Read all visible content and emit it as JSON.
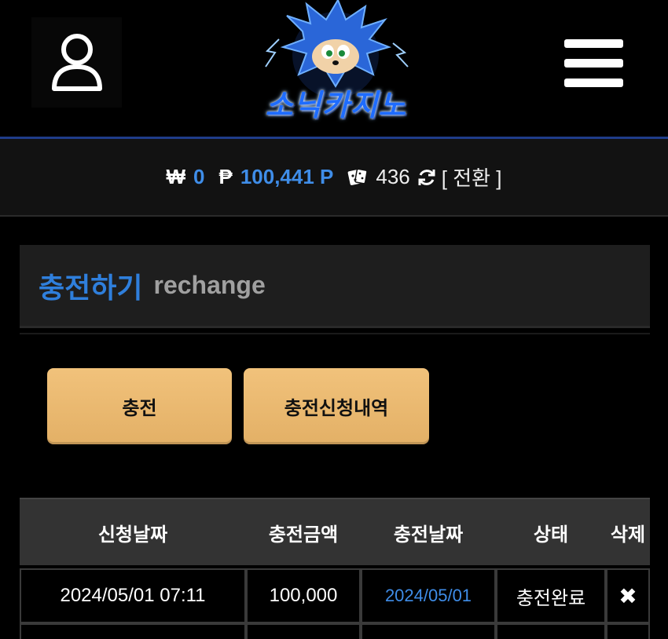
{
  "header": {
    "logo_text": "소닉카지노",
    "user_icon": "user-icon",
    "menu_icon": "hamburger-icon"
  },
  "balance": {
    "won_symbol": "₩",
    "won_value": "0",
    "point_symbol": "₱",
    "point_value": "100,441 P",
    "dice_icon": "dice-icon",
    "dice_value": "436",
    "refresh_icon": "refresh-icon",
    "convert_label": "[ 전환 ]"
  },
  "page": {
    "title_ko": "충전하기",
    "title_en": "rechange"
  },
  "buttons": {
    "charge": "충전",
    "history": "충전신청내역"
  },
  "table": {
    "headers": [
      "신청날짜",
      "충전금액",
      "충전날짜",
      "상태",
      "삭제"
    ],
    "rows": [
      {
        "request_date": "2024/05/01 07:11",
        "amount": "100,000",
        "charge_date": "2024/05/01",
        "status": "충전완료",
        "delete": "✖"
      }
    ]
  },
  "colors": {
    "accent_blue": "#2f7fdc",
    "button_gold": "#e9b86f",
    "header_line": "#1f3c8a"
  }
}
